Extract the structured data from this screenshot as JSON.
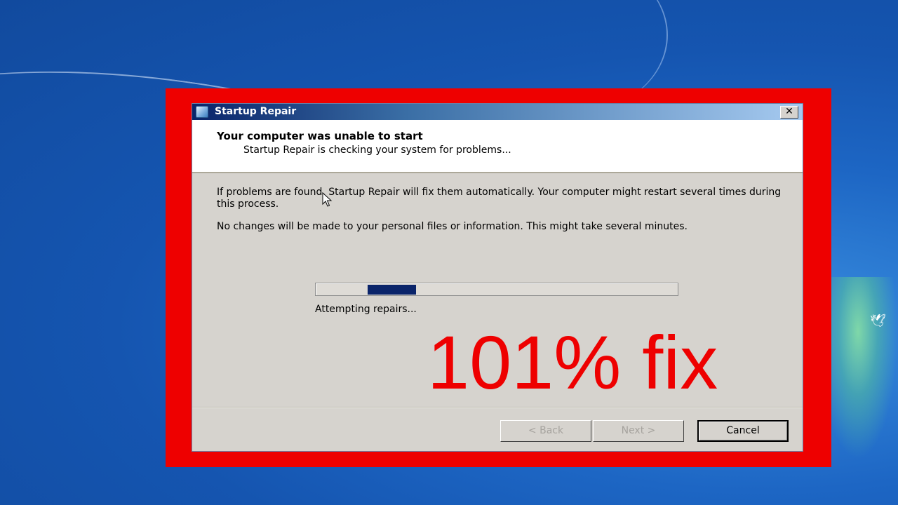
{
  "window": {
    "title": "Startup Repair",
    "close_glyph": "✕"
  },
  "header": {
    "title": "Your computer was unable to start",
    "subtitle": "Startup Repair is checking your system for problems..."
  },
  "body": {
    "paragraph1": "If problems are found, Startup Repair will fix them automatically. Your computer might restart several times during this process.",
    "paragraph2": "No changes will be made to your personal files or information. This might take several minutes."
  },
  "progress": {
    "style": "marquee",
    "status_text": "Attempting repairs..."
  },
  "overlay": {
    "text": "101% fix",
    "color": "#ee0000"
  },
  "buttons": {
    "back": "< Back",
    "next": "Next >",
    "cancel": "Cancel"
  },
  "colors": {
    "frame_red": "#ee0000",
    "progress_fill": "#0a246a",
    "dialog_bg": "#d6d3ce"
  },
  "icons": [
    "startup-repair-app-icon",
    "close-icon",
    "mouse-cursor-icon",
    "bird-icon"
  ]
}
